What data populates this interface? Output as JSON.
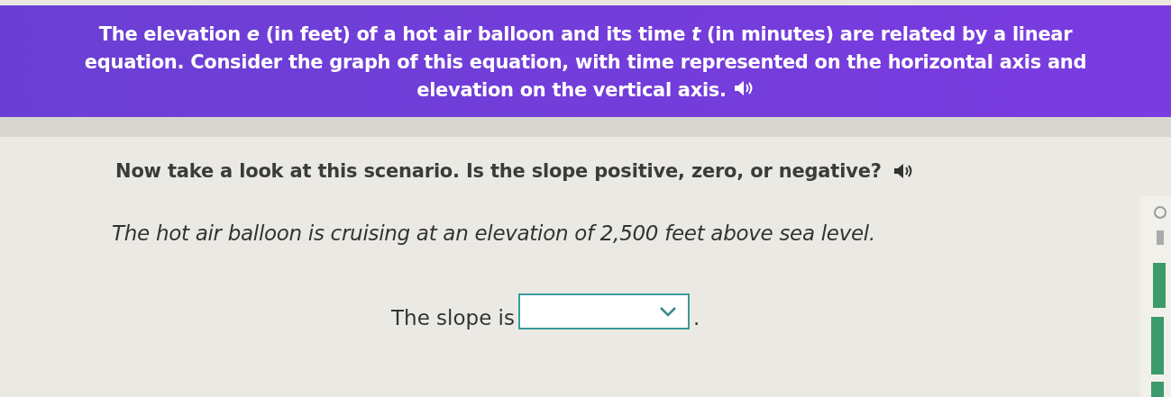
{
  "header": {
    "text": "The elevation *e* (in feet) of a hot air balloon and its time *t* (in minutes) are related by a linear equation. Consider the graph of this equation, with time represented on the horizontal axis and elevation on the vertical axis."
  },
  "question": {
    "text": "Now take a look at this scenario. Is the slope positive, zero, or negative?"
  },
  "scenario": "The hot air balloon is cruising at an elevation of 2,500 feet above sea level.",
  "answer": {
    "prefix": "The slope is",
    "suffix": "."
  }
}
